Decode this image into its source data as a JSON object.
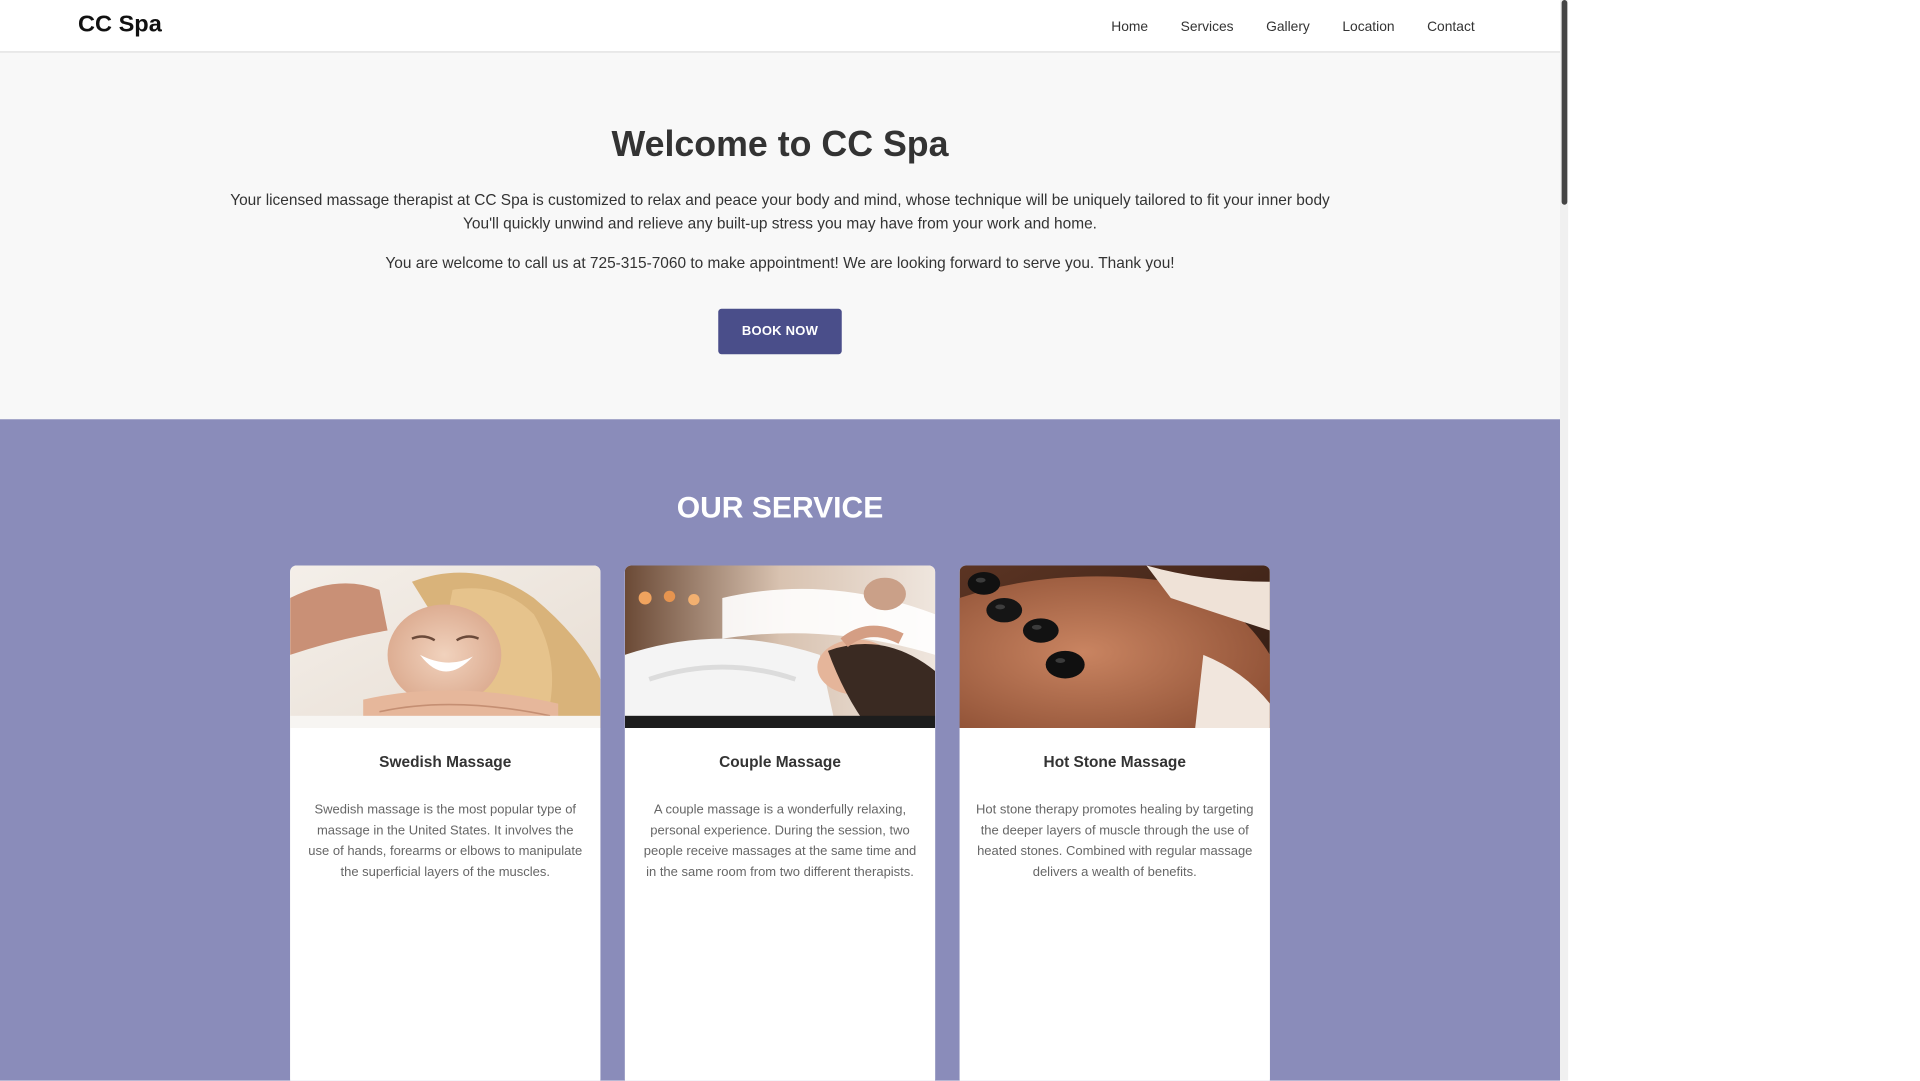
{
  "header": {
    "brand": "CC Spa",
    "nav": [
      "Home",
      "Services",
      "Gallery",
      "Location",
      "Contact"
    ]
  },
  "hero": {
    "title": "Welcome to CC Spa",
    "description_line1": "Your licensed massage therapist at CC Spa is customized to relax and peace your body and mind, whose technique will be uniquely tailored to fit your inner body",
    "description_line2": "You'll quickly unwind and relieve any built-up stress you may have from your work and home.",
    "call_text": "You are welcome to call us at 725-315-7060 to make appointment! We are looking forward to serve you. Thank you!",
    "button_label": "BOOK NOW"
  },
  "services": {
    "title": "OUR SERVICE",
    "cards": [
      {
        "title": "Swedish Massage",
        "description": "Swedish massage is the most popular type of massage in the United States. It involves the use of hands, forearms or elbows to manipulate the superficial layers of the muscles."
      },
      {
        "title": "Couple Massage",
        "description": "A couple massage is a wonderfully relaxing, personal experience. During the session, two people receive massages at the same time and in the same room from two different therapists."
      },
      {
        "title": "Hot Stone Massage",
        "description": "Hot stone therapy promotes healing by targeting the deeper layers of muscle through the use of heated stones. Combined with regular massage delivers a wealth of benefits."
      }
    ]
  },
  "colors": {
    "accent": "#4a4e8a",
    "services_bg": "#8a8cba",
    "hero_bg": "#f8f8f8"
  }
}
